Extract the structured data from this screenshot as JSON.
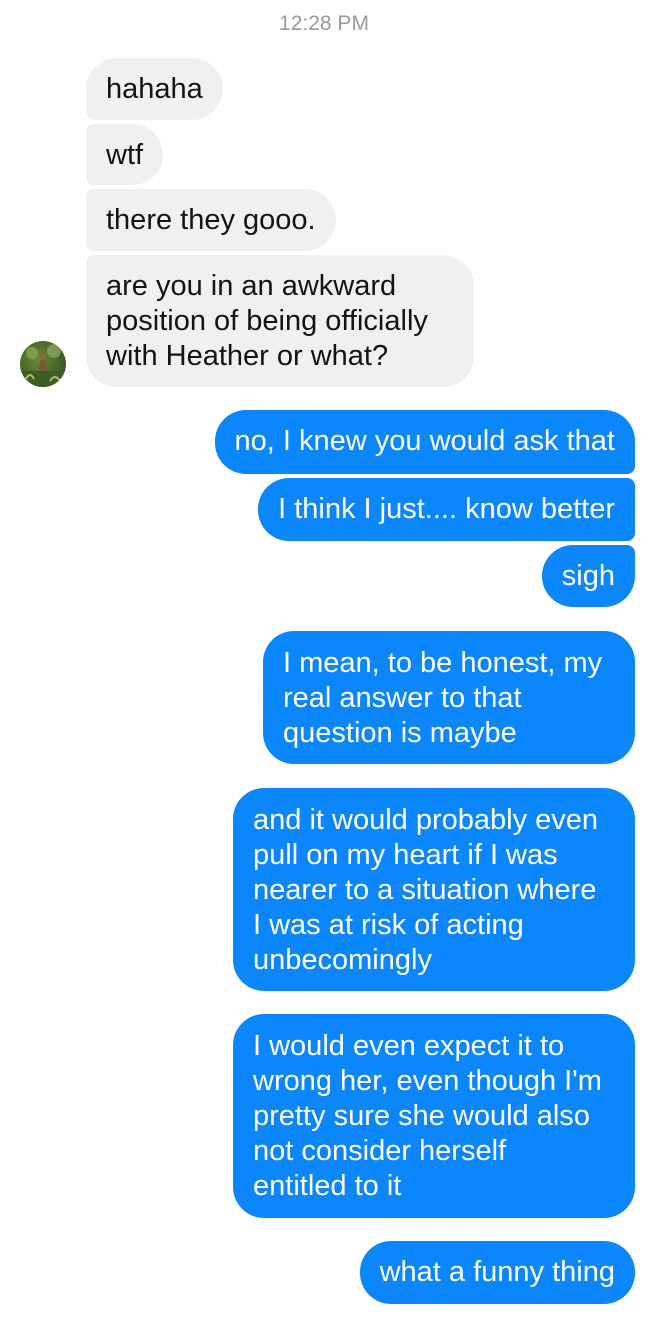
{
  "timestamp": "12:28 PM",
  "incoming": [
    "hahaha",
    "wtf",
    "there they gooo.",
    "are you in an awkward\nposition of being officially\nwith Heather or what?"
  ],
  "outgoing": [
    "no, I knew you would ask that",
    "I think I just.... know better",
    "sigh",
    "I mean, to be honest, my\nreal answer to that\nquestion is maybe",
    "and it would probably even\npull on my heart if I was\nnearer to a situation where\nI was at risk of acting\nunbecomingly",
    "I would even expect it to\nwrong her, even though I'm\npretty sure she would also\nnot consider herself\nentitled to it",
    "what a funny thing"
  ],
  "colors": {
    "incoming_bubble": "#f1f0f0",
    "outgoing_bubble": "#0b86fb",
    "timestamp_text": "#9a9a9a"
  },
  "icons": {
    "avatar": "contact-avatar"
  }
}
